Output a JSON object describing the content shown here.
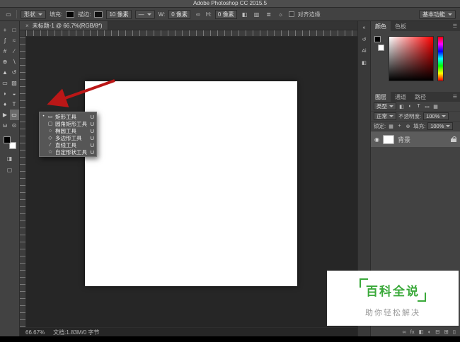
{
  "titlebar": {
    "title": "Adobe Photoshop CC 2015.5"
  },
  "options": {
    "tool_icon": "▭",
    "mode": "形状",
    "fill_label": "填充:",
    "stroke_label": "描边:",
    "stroke_width": "10 像素",
    "line_icon": "—",
    "w_label": "W:",
    "w_value": "0 像素",
    "link_icon": "∞",
    "h_label": "H:",
    "h_value": "0 像素",
    "path_ops_icon": "◧",
    "path_align_icon": "▥",
    "path_arrange_icon": "≣",
    "gear_icon": "☼",
    "align_edges": "对齐边缘",
    "workspace": "基本功能"
  },
  "tab": {
    "close": "×",
    "title": "未标题-1 @ 66.7%(RGB/8*)"
  },
  "toolbar": {
    "tools": [
      {
        "name": "move-tool",
        "glyph": "+"
      },
      {
        "name": "marquee-tool",
        "glyph": "□"
      },
      {
        "name": "lasso-tool",
        "glyph": "ʃ"
      },
      {
        "name": "quick-selection-tool",
        "glyph": "≈"
      },
      {
        "name": "crop-tool",
        "glyph": "#"
      },
      {
        "name": "eyedropper-tool",
        "glyph": "∕"
      },
      {
        "name": "healing-brush-tool",
        "glyph": "⊕"
      },
      {
        "name": "brush-tool",
        "glyph": "∖"
      },
      {
        "name": "clone-stamp-tool",
        "glyph": "▲"
      },
      {
        "name": "history-brush-tool",
        "glyph": "↺"
      },
      {
        "name": "eraser-tool",
        "glyph": "▭"
      },
      {
        "name": "gradient-tool",
        "glyph": "▨"
      },
      {
        "name": "blur-tool",
        "glyph": "◗"
      },
      {
        "name": "dodge-tool",
        "glyph": "◒"
      },
      {
        "name": "pen-tool",
        "glyph": "♦"
      },
      {
        "name": "type-tool",
        "glyph": "T"
      },
      {
        "name": "path-selection-tool",
        "glyph": "▶"
      },
      {
        "name": "rectangle-tool",
        "glyph": "▭"
      },
      {
        "name": "hand-tool",
        "glyph": "ω"
      },
      {
        "name": "zoom-tool",
        "glyph": "⊙"
      }
    ]
  },
  "flyout": {
    "items": [
      {
        "marker": "•",
        "glyph": "▭",
        "label": "矩形工具",
        "shortcut": "U"
      },
      {
        "marker": "",
        "glyph": "▢",
        "label": "圆角矩形工具",
        "shortcut": "U"
      },
      {
        "marker": "",
        "glyph": "○",
        "label": "椭圆工具",
        "shortcut": "U"
      },
      {
        "marker": "",
        "glyph": "◇",
        "label": "多边形工具",
        "shortcut": "U"
      },
      {
        "marker": "",
        "glyph": "∕",
        "label": "直线工具",
        "shortcut": "U"
      },
      {
        "marker": "",
        "glyph": "☆",
        "label": "自定形状工具",
        "shortcut": "U"
      }
    ]
  },
  "right_strip": {
    "icons": [
      {
        "name": "collapse-panels-icon",
        "glyph": "«"
      },
      {
        "name": "history-panel-icon",
        "glyph": "↺"
      },
      {
        "name": "learn-panel-icon",
        "glyph": "Ai"
      },
      {
        "name": "properties-panel-icon",
        "glyph": "◧"
      }
    ]
  },
  "color_panel": {
    "tabs": [
      "颜色",
      "色板"
    ],
    "menu_icon": "☰"
  },
  "layers_panel": {
    "tabs": [
      "图层",
      "通道",
      "路径"
    ],
    "menu_icon": "☰",
    "filter_label": "类型",
    "filter_icons": [
      "◧",
      "◐",
      "T",
      "▭",
      "▦"
    ],
    "blend_mode": "正常",
    "opacity_label": "不透明度:",
    "opacity_value": "100%",
    "lock_label": "锁定:",
    "lock_icons": [
      "▦",
      "+",
      "⊕"
    ],
    "fill_label": "填充:",
    "fill_value": "100%",
    "layer_name": "背景",
    "eye_icon": "◉",
    "bottom_icons": [
      {
        "name": "link-layers-icon",
        "glyph": "∞"
      },
      {
        "name": "layer-effects-icon",
        "glyph": "fx"
      },
      {
        "name": "layer-mask-icon",
        "glyph": "◧"
      },
      {
        "name": "adjustment-layer-icon",
        "glyph": "◐"
      },
      {
        "name": "layer-group-icon",
        "glyph": "⊟"
      },
      {
        "name": "new-layer-icon",
        "glyph": "⊞"
      },
      {
        "name": "delete-layer-icon",
        "glyph": "▯"
      }
    ]
  },
  "status": {
    "zoom": "66.67%",
    "doc": "文档:1.83M/0 字节"
  },
  "watermark": {
    "title": "百科全说",
    "subtitle": "助你轻松解决"
  }
}
